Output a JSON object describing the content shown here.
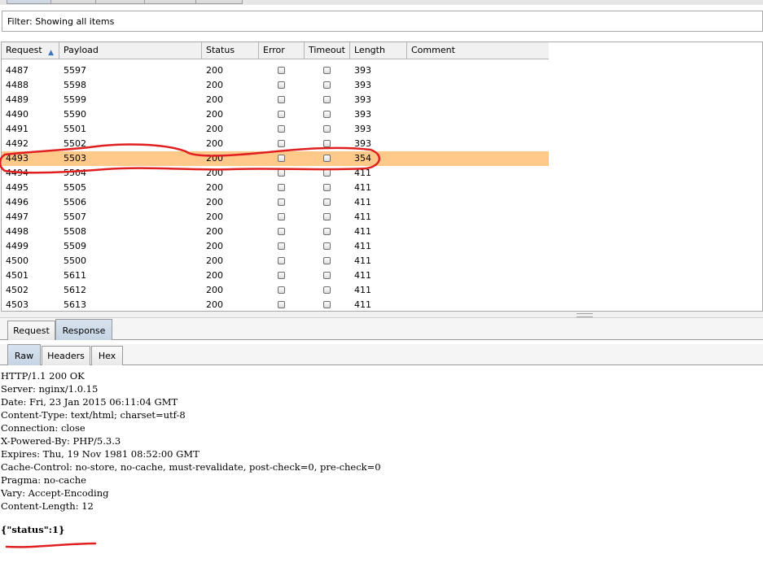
{
  "filter": {
    "text": "Filter: Showing all items"
  },
  "table": {
    "columns": [
      "Request",
      "Payload",
      "Status",
      "Error",
      "Timeout",
      "Length",
      "Comment"
    ],
    "sort_indicator": "▲",
    "rows": [
      {
        "request": "4487",
        "payload": "5597",
        "status": "200",
        "length": "393"
      },
      {
        "request": "4488",
        "payload": "5598",
        "status": "200",
        "length": "393"
      },
      {
        "request": "4489",
        "payload": "5599",
        "status": "200",
        "length": "393"
      },
      {
        "request": "4490",
        "payload": "5590",
        "status": "200",
        "length": "393"
      },
      {
        "request": "4491",
        "payload": "5501",
        "status": "200",
        "length": "393"
      },
      {
        "request": "4492",
        "payload": "5502",
        "status": "200",
        "length": "393"
      },
      {
        "request": "4493",
        "payload": "5503",
        "status": "200",
        "length": "354",
        "selected": true
      },
      {
        "request": "4494",
        "payload": "5504",
        "status": "200",
        "length": "411"
      },
      {
        "request": "4495",
        "payload": "5505",
        "status": "200",
        "length": "411"
      },
      {
        "request": "4496",
        "payload": "5506",
        "status": "200",
        "length": "411"
      },
      {
        "request": "4497",
        "payload": "5507",
        "status": "200",
        "length": "411"
      },
      {
        "request": "4498",
        "payload": "5508",
        "status": "200",
        "length": "411"
      },
      {
        "request": "4499",
        "payload": "5509",
        "status": "200",
        "length": "411"
      },
      {
        "request": "4500",
        "payload": "5500",
        "status": "200",
        "length": "411"
      },
      {
        "request": "4501",
        "payload": "5611",
        "status": "200",
        "length": "411"
      },
      {
        "request": "4502",
        "payload": "5612",
        "status": "200",
        "length": "411"
      },
      {
        "request": "4503",
        "payload": "5613",
        "status": "200",
        "length": "411"
      }
    ]
  },
  "tabs_main": [
    "Request",
    "Response"
  ],
  "tabs_view": [
    "Raw",
    "Headers",
    "Hex"
  ],
  "response": {
    "lines": [
      "HTTP/1.1 200 OK",
      "Server: nginx/1.0.15",
      "Date: Fri, 23 Jan 2015 06:11:04 GMT",
      "Content-Type: text/html; charset=utf-8",
      "Connection: close",
      "X-Powered-By: PHP/5.3.3",
      "Expires: Thu, 19 Nov 1981 08:52:00 GMT",
      "Cache-Control: no-store, no-cache, must-revalidate, post-check=0, pre-check=0",
      "Pragma: no-cache",
      "Vary: Accept-Encoding",
      "Content-Length: 12"
    ],
    "body": "{\"status\":1}"
  },
  "colors": {
    "selected_row": "#ffc98a",
    "annotation": "#e02020",
    "sort_arrow": "#3e77c2"
  }
}
